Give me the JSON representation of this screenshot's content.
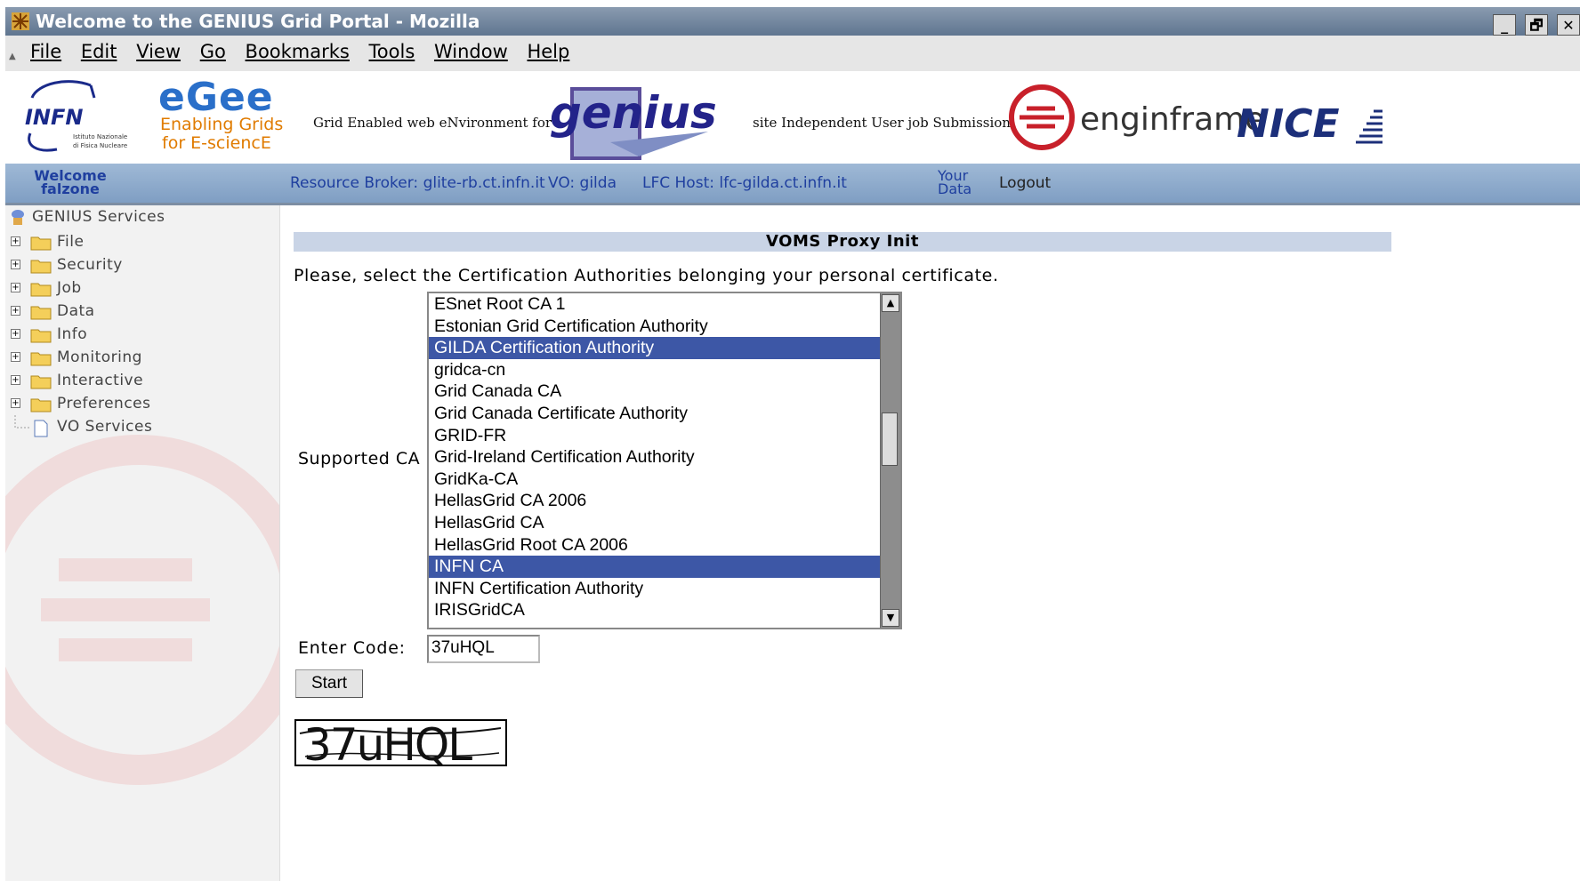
{
  "window": {
    "title": "Welcome to the GENIUS Grid Portal - Mozilla",
    "controls": [
      "_",
      "🗗",
      "✕"
    ]
  },
  "menu": [
    "File",
    "Edit",
    "View",
    "Go",
    "Bookmarks",
    "Tools",
    "Window",
    "Help"
  ],
  "banner": {
    "infn_text": "INFN",
    "infn_sub1": "Istituto Nazionale",
    "infn_sub2": "di Fisica Nucleare",
    "egee_logo": "eGee",
    "egee_line1": "Enabling Grids",
    "egee_line2": "for E-sciencE",
    "genius_desc_a": "Grid Enabled web eNvironment for",
    "genius_logo": "genius",
    "genius_desc_b": "site Independent User job Submission",
    "enginframe_logo": "enginframe",
    "nice_logo": "NICE"
  },
  "nav": {
    "welcome": "Welcome",
    "user": "falzone",
    "resource_broker": "Resource Broker: glite-rb.ct.infn.it",
    "vo": "VO: gilda",
    "lfc_host": "LFC Host: lfc-gilda.ct.infn.it",
    "your": "Your",
    "data": "Data",
    "logout": "Logout"
  },
  "sidebar": {
    "root": "GENIUS Services",
    "items": [
      "File",
      "Security",
      "Job",
      "Data",
      "Info",
      "Monitoring",
      "Interactive",
      "Preferences",
      "VO Services"
    ]
  },
  "main": {
    "header": "VOMS Proxy Init",
    "instruction": "Please, select the Certification Authorities belonging your personal certificate.",
    "supported_ca_label": "Supported CA",
    "ca_list": [
      "ESnet Root CA 1",
      "Estonian Grid Certification Authority",
      "GILDA Certification Authority",
      "gridca-cn",
      "Grid Canada CA",
      "Grid Canada Certificate Authority",
      "GRID-FR",
      "Grid-Ireland Certification Authority",
      "GridKa-CA",
      "HellasGrid CA 2006",
      "HellasGrid CA",
      "HellasGrid Root CA 2006",
      "INFN CA",
      "INFN Certification Authority",
      "IRISGridCA"
    ],
    "selected_ca": [
      "GILDA Certification Authority",
      "INFN CA"
    ],
    "code_label": "Enter Code:",
    "code_value": "37uHQL",
    "start_label": "Start",
    "captcha_text": "37uHQL"
  },
  "colors": {
    "selection": "#3d57a6",
    "nav_bar": "#8fabcc",
    "header_bar": "#c9d4e6",
    "link_blue": "#1f3f9f"
  }
}
